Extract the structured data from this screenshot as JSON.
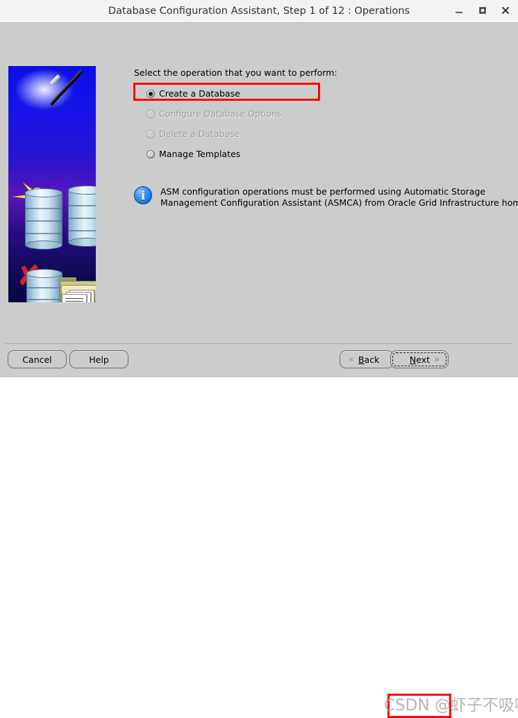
{
  "window": {
    "title": "Database Configuration Assistant, Step 1 of 12 : Operations",
    "controls": {
      "minimize": "minimize",
      "maximize": "maximize",
      "close": "close"
    }
  },
  "main": {
    "prompt": "Select the operation that you want to perform:",
    "options": [
      {
        "label": "Create a Database",
        "selected": true,
        "disabled": false
      },
      {
        "label": "Configure Database Options",
        "selected": false,
        "disabled": true
      },
      {
        "label": "Delete a Database",
        "selected": false,
        "disabled": true
      },
      {
        "label": "Manage Templates",
        "selected": false,
        "disabled": false
      }
    ],
    "info": {
      "icon": "info-icon",
      "line1": "ASM configuration operations must be performed using Automatic Storage",
      "line2": "Management Configuration Assistant (ASMCA) from Oracle Grid Infrastructure home."
    }
  },
  "footer": {
    "cancel": "Cancel",
    "help": "Help",
    "back": "Back",
    "back_mnemonic": "B",
    "back_rest": "ack",
    "next": "Next",
    "next_mnemonic": "N",
    "next_rest": "ext",
    "back_chevron": "«",
    "next_chevron": "»"
  },
  "overlay": {
    "watermark": "CSDN @虾子不吸吸",
    "highlight_color": "#fb0007"
  }
}
